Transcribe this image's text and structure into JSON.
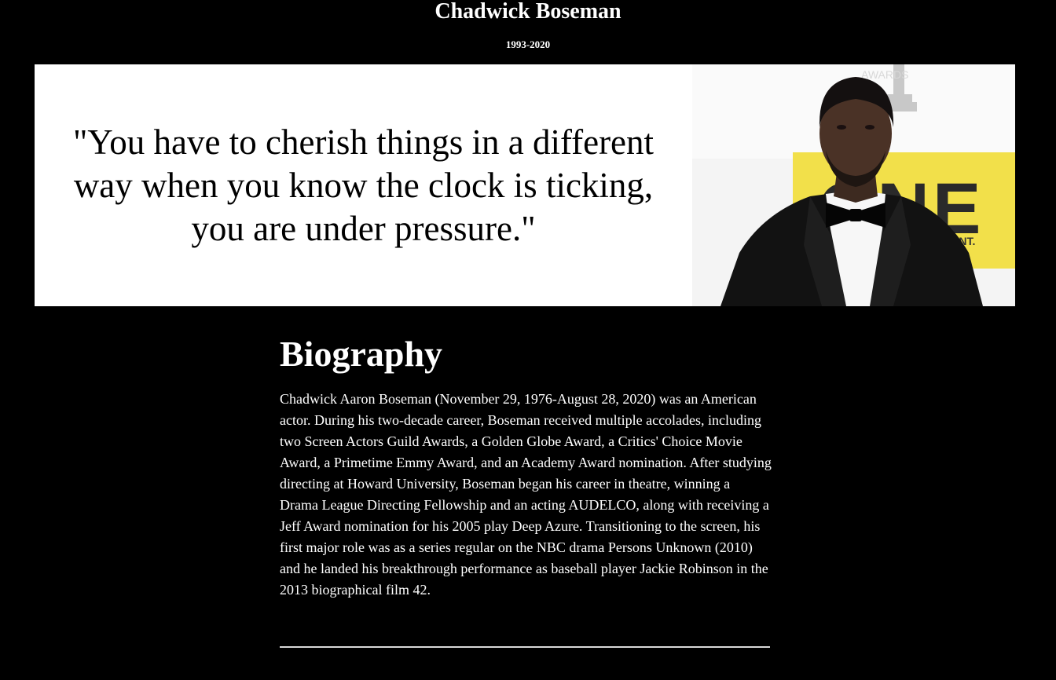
{
  "header": {
    "title": "Chadwick Boseman",
    "years": "1993-2020"
  },
  "hero": {
    "quote": "\"You have to cherish things in a different way when you know the clock is ticking, you are under pressure.\"",
    "photo_subject": "portrait-photo",
    "photo_backdrop_text": "ONE",
    "photo_backdrop_small": "AWARDS",
    "photo_backdrop_ent": "ENT."
  },
  "bio": {
    "heading": "Biography",
    "text": "Chadwick Aaron Boseman (November 29, 1976-August 28, 2020) was an American actor. During his two-decade career, Boseman received multiple accolades, including two Screen Actors Guild Awards, a Golden Globe Award, a Critics' Choice Movie Award, a Primetime Emmy Award, and an Academy Award nomination. After studying directing at Howard University, Boseman began his career in theatre, winning a Drama League Directing Fellowship and an acting AUDELCO, along with receiving a Jeff Award nomination for his 2005 play Deep Azure. Transitioning to the screen, his first major role was as a series regular on the NBC drama Persons Unknown (2010) and he landed his breakthrough performance as baseball player Jackie Robinson in the 2013 biographical film 42."
  },
  "colors": {
    "background": "#000000",
    "text": "#ffffff",
    "hero_background": "#ffffff",
    "quote_text": "#000000",
    "backdrop_yellow": "#f2e04a"
  }
}
